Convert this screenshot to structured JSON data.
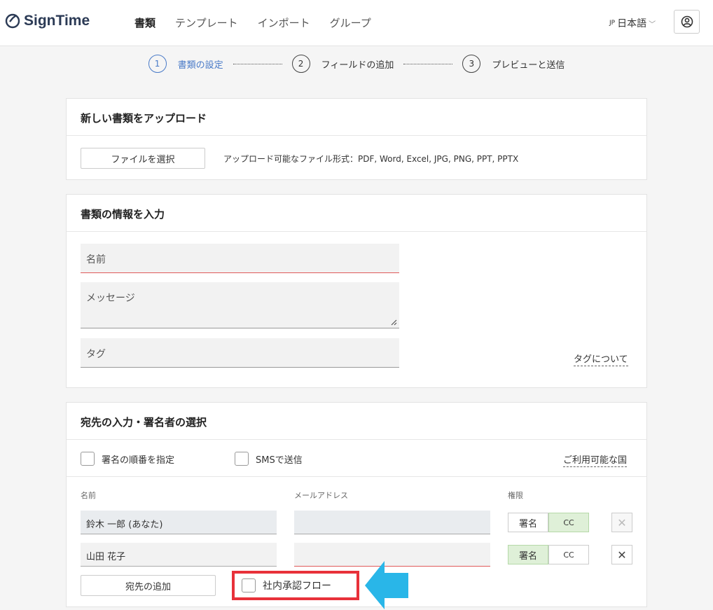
{
  "app": {
    "name": "SignTime"
  },
  "nav": {
    "items": [
      "書類",
      "テンプレート",
      "インポート",
      "グループ"
    ],
    "active": 0
  },
  "lang": {
    "prefix": "JP",
    "label": "日本語"
  },
  "steps": [
    {
      "num": "1",
      "label": "書類の設定",
      "active": true
    },
    {
      "num": "2",
      "label": "フィールドの追加",
      "active": false
    },
    {
      "num": "3",
      "label": "プレビューと送信",
      "active": false
    }
  ],
  "upload": {
    "title": "新しい書類をアップロード",
    "button": "ファイルを選択",
    "formats": "アップロード可能なファイル形式：PDF, Word, Excel, JPG, PNG, PPT, PPTX"
  },
  "info": {
    "title": "書類の情報を入力",
    "name_placeholder": "名前",
    "message_placeholder": "メッセージ",
    "tag_placeholder": "タグ",
    "tag_link": "タグについて"
  },
  "recipients": {
    "title": "宛先の入力・署名者の選択",
    "order_checkbox": "署名の順番を指定",
    "sms_checkbox": "SMSで送信",
    "countries_link": "ご利用可能な国",
    "col_name": "名前",
    "col_email": "メールアドレス",
    "col_permission": "権限",
    "sign_label": "署名",
    "cc_label": "CC",
    "rows": [
      {
        "name": "鈴木 一郎 (あなた)",
        "email": "",
        "selected": "cc"
      },
      {
        "name": "山田 花子",
        "email": "",
        "selected": "sign"
      }
    ],
    "add_button": "宛先の追加",
    "approval_checkbox": "社内承認フロー"
  },
  "colors": {
    "accent": "#4a7bc8",
    "highlight": "#e8313a",
    "arrow": "#29b6e8"
  }
}
